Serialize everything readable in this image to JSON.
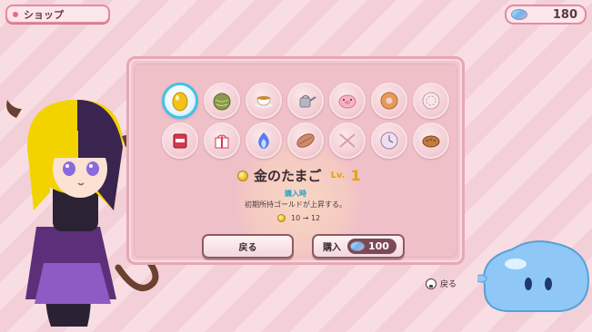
{
  "header": {
    "title": "ショップ"
  },
  "currency": {
    "icon": "gem-icon",
    "value": "180"
  },
  "shop": {
    "items": [
      {
        "icon": "golden-egg-icon",
        "selected": true
      },
      {
        "icon": "melon-icon"
      },
      {
        "icon": "teacup-icon"
      },
      {
        "icon": "watering-can-icon"
      },
      {
        "icon": "pig-icon"
      },
      {
        "icon": "donut-icon"
      },
      {
        "icon": "plate-icon"
      },
      {
        "icon": "protein-icon"
      },
      {
        "icon": "gift-box-icon"
      },
      {
        "icon": "blue-flame-icon"
      },
      {
        "icon": "leaf-cookie-icon"
      },
      {
        "icon": "crossed-sticks-icon"
      },
      {
        "icon": "clock-icon"
      },
      {
        "icon": "bread-icon"
      }
    ],
    "selected_item": {
      "name": "金のたまご",
      "level_label": "Lv.",
      "level": "1",
      "effect_label": "購入時",
      "effect_description": "初期所持ゴールドが上昇する。",
      "effect_value": "10 → 12"
    },
    "back_button": "戻る",
    "buy_button": "購入",
    "price": "100"
  },
  "footer_hint": {
    "label": "戻る"
  },
  "colors": {
    "accent": "#e58aa0",
    "selected_ring": "#3fc3e8",
    "level": "#e6a400"
  }
}
